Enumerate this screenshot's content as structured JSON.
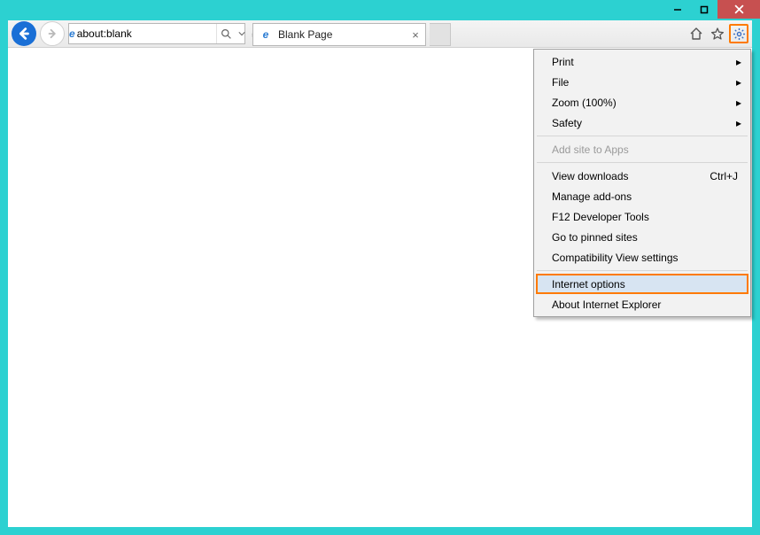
{
  "address": {
    "url": "about:blank"
  },
  "tab": {
    "title": "Blank Page"
  },
  "menu": {
    "print": "Print",
    "file": "File",
    "zoom": "Zoom (100%)",
    "safety": "Safety",
    "addSite": "Add site to Apps",
    "viewDownloads": "View downloads",
    "viewDownloadsShortcut": "Ctrl+J",
    "manageAddons": "Manage add-ons",
    "f12": "F12 Developer Tools",
    "pinnedSites": "Go to pinned sites",
    "compat": "Compatibility View settings",
    "internetOptions": "Internet options",
    "about": "About Internet Explorer"
  }
}
